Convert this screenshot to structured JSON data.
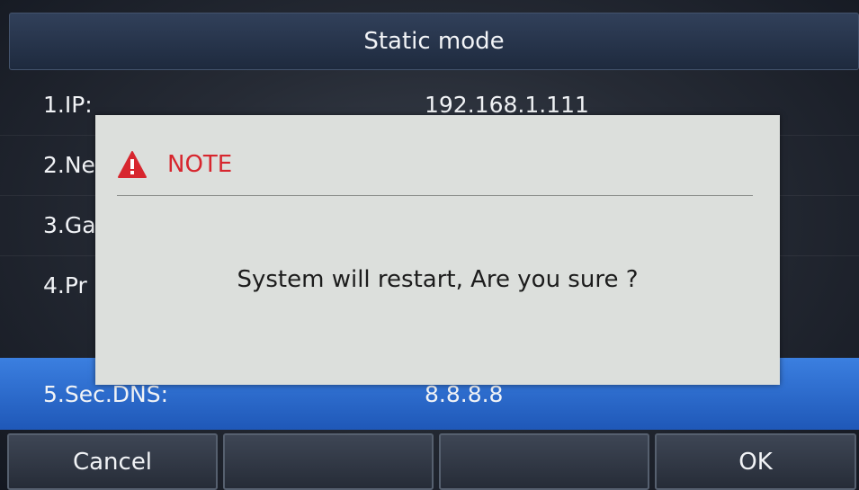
{
  "header": {
    "title": "Static mode"
  },
  "rows": [
    {
      "label": "1.IP:",
      "value": "192.168.1.111"
    },
    {
      "label": "2.Ne",
      "value": ""
    },
    {
      "label": "3.Ga",
      "value": ""
    },
    {
      "label": "4.Pr",
      "value": ""
    },
    {
      "label": "5.Sec.DNS:",
      "value": "8.8.8.8",
      "selected": true
    }
  ],
  "dialog": {
    "icon": "warning-triangle-icon",
    "title": "NOTE",
    "message": "System will restart, Are you sure ?",
    "title_color": "#d7262e"
  },
  "softkeys": [
    "Cancel",
    "",
    "",
    "OK"
  ],
  "colors": {
    "selection": "#2b6ad0",
    "dialog_bg": "#dcdfdc"
  }
}
